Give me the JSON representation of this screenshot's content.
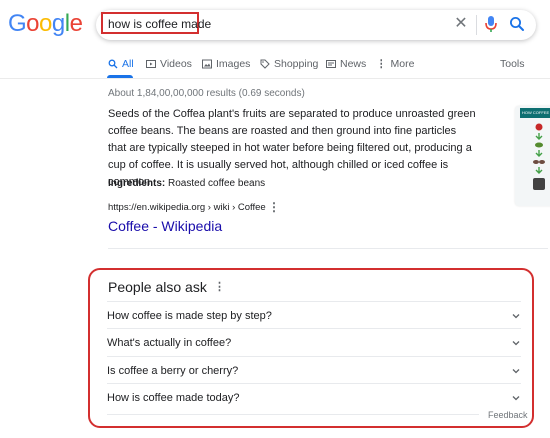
{
  "logo": {
    "letters": [
      "G",
      "o",
      "o",
      "g",
      "l",
      "e"
    ],
    "colors": [
      "#4285F4",
      "#EA4335",
      "#FBBC05",
      "#4285F4",
      "#34A853",
      "#EA4335"
    ]
  },
  "search": {
    "query": "how is coffee made"
  },
  "tabs": [
    {
      "label": "All",
      "icon": "search-icon",
      "active": true
    },
    {
      "label": "Videos",
      "icon": "video-icon"
    },
    {
      "label": "Images",
      "icon": "image-icon"
    },
    {
      "label": "Shopping",
      "icon": "tag-icon"
    },
    {
      "label": "News",
      "icon": "news-icon"
    },
    {
      "label": "More",
      "icon": "more-vert-icon"
    }
  ],
  "tools_label": "Tools",
  "results_stats": "About 1,84,00,00,000 results (0.69 seconds)",
  "featured_snippet": {
    "text": "Seeds of the Coffea plant's fruits are separated to produce unroasted green coffee beans. The beans are roasted and then ground into fine particles that are typically steeped in hot water before being filtered out, producing a cup of coffee. It is usually served hot, although chilled or iced coffee is common.",
    "ingredients_label": "Ingredients:",
    "ingredients_value": "Roasted coffee beans",
    "url": "https://en.wikipedia.org › wiki › Coffee",
    "title": "Coffee - Wikipedia",
    "thumbnail_title": "HOW COFFEE"
  },
  "people_also_ask": {
    "heading": "People also ask",
    "questions": [
      "How coffee is made step by step?",
      "What's actually in coffee?",
      "Is coffee a berry or cherry?",
      "How is coffee made today?"
    ],
    "feedback": "Feedback"
  },
  "colors": {
    "accent": "#1a73e8",
    "link": "#1a0dab",
    "highlight": "#d32f2f"
  }
}
